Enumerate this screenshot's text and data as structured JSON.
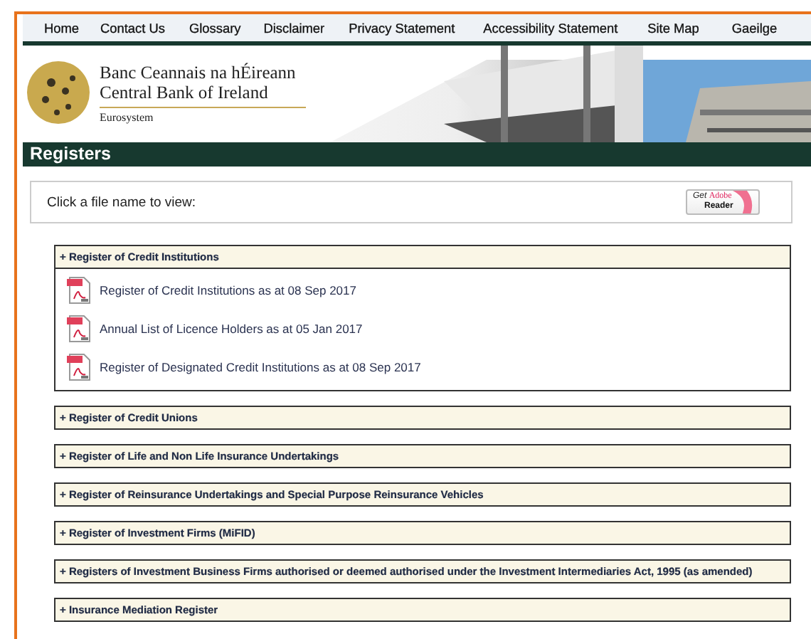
{
  "nav": [
    "Home",
    "Contact Us",
    "Glossary",
    "Disclaimer",
    "Privacy Statement",
    "Accessibility Statement",
    "Site Map",
    "Gaeilge"
  ],
  "header": {
    "title_irish": "Banc Ceannais na hÉireann",
    "title_english": "Central Bank of Ireland",
    "subtitle": "Eurosystem"
  },
  "page_title": "Registers",
  "instructions": {
    "text": "Click a file name to view:",
    "badge": {
      "get": "Get",
      "brand": "Adobe",
      "product": "Reader"
    }
  },
  "sections": [
    {
      "title": "+ Register of Credit Institutions",
      "expanded": true,
      "files": [
        {
          "name": "Register of Credit Institutions as at 08 Sep 2017"
        },
        {
          "name": "Annual List of Licence Holders as at 05 Jan 2017"
        },
        {
          "name": "Register of Designated Credit Institutions as at 08 Sep 2017"
        }
      ]
    },
    {
      "title": "+ Register of Credit Unions",
      "expanded": false
    },
    {
      "title": "+ Register of Life and Non Life Insurance Undertakings",
      "expanded": false
    },
    {
      "title": "+ Register of Reinsurance Undertakings and Special Purpose Reinsurance Vehicles",
      "expanded": false
    },
    {
      "title": "+ Register of Investment Firms (MiFID)",
      "expanded": false
    },
    {
      "title": "+ Registers of Investment Business Firms authorised or deemed authorised under the Investment Intermediaries Act, 1995 (as amended)",
      "expanded": false
    },
    {
      "title": "+ Insurance Mediation Register",
      "expanded": false
    }
  ]
}
